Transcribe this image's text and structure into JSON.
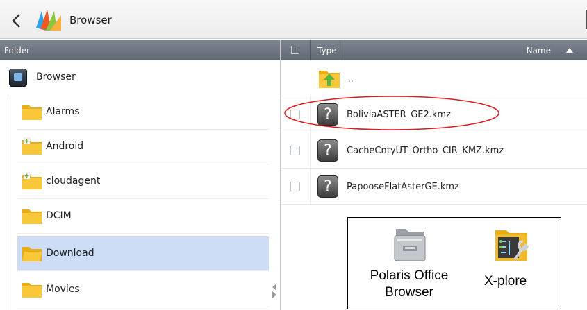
{
  "titlebar": {
    "title": "Browser"
  },
  "folder_panel": {
    "header": "Folder",
    "root": "Browser",
    "folders": [
      {
        "label": "Alarms",
        "icon": "folder-icon",
        "selected": false
      },
      {
        "label": "Android",
        "icon": "folder-plus-icon",
        "selected": false
      },
      {
        "label": "cloudagent",
        "icon": "folder-plus-icon",
        "selected": false
      },
      {
        "label": "DCIM",
        "icon": "folder-icon",
        "selected": false
      },
      {
        "label": "Download",
        "icon": "folder-open-icon",
        "selected": true
      },
      {
        "label": "Movies",
        "icon": "folder-icon",
        "selected": false
      }
    ]
  },
  "file_panel": {
    "col_type": "Type",
    "col_name": "Name",
    "parent": "..",
    "files": [
      {
        "name": "BoliviaASTER_GE2.kmz",
        "icon": "unknown-file-icon"
      },
      {
        "name": "CacheCntyUT_Ortho_CIR_KMZ.kmz",
        "icon": "unknown-file-icon"
      },
      {
        "name": "PapooseFlatAsterGE.kmz",
        "icon": "unknown-file-icon"
      }
    ],
    "highlight_color": "#e0191e"
  },
  "apps": [
    {
      "label": "Polaris Office Browser",
      "icon": "polaris-office-browser-icon"
    },
    {
      "label": "X-plore",
      "icon": "x-plore-icon"
    }
  ],
  "colors": {
    "header": "#6c7580",
    "selected_row": "#cdddf6",
    "folder": "#f6c12b"
  }
}
